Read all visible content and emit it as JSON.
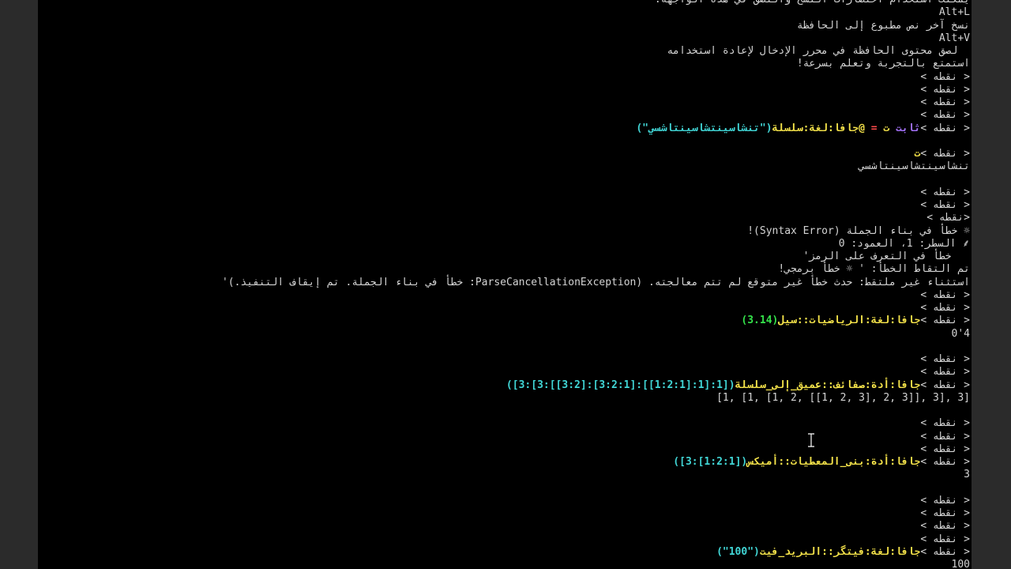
{
  "colors": {
    "background": "#000000",
    "frame": "#2b2b2b",
    "text": "#d4d4d4",
    "keyword_yellow": "#f5e34a",
    "string_cyan": "#41d6d6",
    "number_green": "#34e24a",
    "keyword_purple": "#a774ff",
    "operator_red": "#ff4d4d"
  },
  "terminal": {
    "lines": [
      {
        "segments": [
          {
            "text": "يمكنك استخدام اختصارات النسخ واللصق في هذه الواجهة:",
            "color": "text"
          }
        ]
      },
      {
        "segments": [
          {
            "text": "Alt+L",
            "color": "text"
          }
        ]
      },
      {
        "segments": [
          {
            "text": "نسخ آخر نص مطبوع إلى الحافظة",
            "color": "text"
          }
        ]
      },
      {
        "segments": [
          {
            "text": "Alt+V",
            "color": "text"
          }
        ]
      },
      {
        "segments": [
          {
            "text": "  لصق محتوى الحافظة في محرر الإدخال لإعادة استخدامه",
            "color": "text"
          }
        ]
      },
      {
        "segments": [
          {
            "text": "استمتع بالتجربة وتعلم بسرعة!",
            "color": "text"
          }
        ]
      },
      {
        "segments": [
          {
            "text": "< نقطه >",
            "color": "text"
          }
        ]
      },
      {
        "segments": [
          {
            "text": "< نقطه >",
            "color": "text"
          }
        ]
      },
      {
        "segments": [
          {
            "text": "< نقطه >",
            "color": "text"
          }
        ]
      },
      {
        "segments": [
          {
            "text": "< نقطه >",
            "color": "text"
          }
        ]
      },
      {
        "segments": [
          {
            "text": "< نقطه >",
            "color": "text"
          },
          {
            "text": "ثابت ",
            "color": "purple"
          },
          {
            "text": "ت ",
            "color": "yellow"
          },
          {
            "text": "= ",
            "color": "red"
          },
          {
            "text": "@جافا:لغة:سلسلة",
            "color": "yellow"
          },
          {
            "text": "(\"تنشاسينتشاسينتاشسي\")",
            "color": "cyan"
          }
        ]
      },
      {
        "segments": []
      },
      {
        "segments": [
          {
            "text": "< نقطه >",
            "color": "text"
          },
          {
            "text": "ت",
            "color": "yellow"
          }
        ]
      },
      {
        "segments": [
          {
            "text": "تنشاسينتشاسينتاشسي",
            "color": "text"
          }
        ]
      },
      {
        "segments": []
      },
      {
        "segments": [
          {
            "text": "< نقطه >",
            "color": "text"
          }
        ]
      },
      {
        "segments": [
          {
            "text": "< نقطه >",
            "color": "text"
          }
        ]
      },
      {
        "segments": [
          {
            "text": "<نقطه >",
            "color": "text"
          }
        ]
      },
      {
        "segments": [
          {
            "text": "☼ خطأ في بناء الجملة (Syntax Error)!",
            "color": "text"
          }
        ]
      },
      {
        "segments": [
          {
            "text": "⸙ السطر: 1، العمود: 0",
            "color": "text"
          }
        ]
      },
      {
        "segments": [
          {
            "text": "   خطأ في التعرف على الرمز'",
            "color": "text"
          }
        ]
      },
      {
        "segments": [
          {
            "text": "تم التقاط الخطأ: ' ☼ خطأ برمجي!",
            "color": "text"
          }
        ]
      },
      {
        "segments": [
          {
            "text": "استثناء غير ملتقط: حدث خطأ غير متوقع لم تتم معالجته. (ParseCancellationException: خطأ في بناء الجملة. تم إيقاف التنفيذ.)'",
            "color": "text"
          }
        ]
      },
      {
        "segments": [
          {
            "text": "< نقطه >",
            "color": "text"
          }
        ]
      },
      {
        "segments": [
          {
            "text": "< نقطه >",
            "color": "text"
          }
        ]
      },
      {
        "segments": [
          {
            "text": "< نقطه >",
            "color": "text"
          },
          {
            "text": "جافا:لغة:الرياضيات::سيل",
            "color": "yellow"
          },
          {
            "text": "(3.14)",
            "color": "green"
          }
        ]
      },
      {
        "segments": [
          {
            "text": "4'0",
            "color": "text"
          }
        ]
      },
      {
        "segments": []
      },
      {
        "segments": [
          {
            "text": "< نقطه >",
            "color": "text"
          }
        ]
      },
      {
        "segments": [
          {
            "text": "< نقطه >",
            "color": "text"
          }
        ]
      },
      {
        "segments": [
          {
            "text": "< نقطه >",
            "color": "text"
          },
          {
            "text": "جافا:أدة:صفائف::عميق_إلى_سلسلة",
            "color": "yellow"
          },
          {
            "text": "([1:[1:[1:2:1]]:[3:2:1]:[3:2]]:3]:3])",
            "color": "cyan"
          }
        ]
      },
      {
        "segments": [
          {
            "text": "[1, [1, [1, 2, [[1, 2, 3], 2, 3]], 3], 3]",
            "color": "text"
          }
        ],
        "ltr": true
      },
      {
        "segments": []
      },
      {
        "segments": [
          {
            "text": "< نقطه >",
            "color": "text"
          }
        ]
      },
      {
        "segments": [
          {
            "text": "< نقطه >",
            "color": "text"
          }
        ]
      },
      {
        "segments": [
          {
            "text": "< نقطه >",
            "color": "text"
          }
        ]
      },
      {
        "segments": [
          {
            "text": "< نقطه >",
            "color": "text"
          },
          {
            "text": "جافا:أدة:بنى_المعطيات::أميكس",
            "color": "yellow"
          },
          {
            "text": "([1:2:1]:3])",
            "color": "cyan"
          }
        ]
      },
      {
        "segments": [
          {
            "text": "3",
            "color": "text"
          }
        ]
      },
      {
        "segments": []
      },
      {
        "segments": [
          {
            "text": "< نقطه >",
            "color": "text"
          }
        ]
      },
      {
        "segments": [
          {
            "text": "< نقطه >",
            "color": "text"
          }
        ]
      },
      {
        "segments": [
          {
            "text": "< نقطه >",
            "color": "text"
          }
        ]
      },
      {
        "segments": [
          {
            "text": "< نقطه >",
            "color": "text"
          }
        ]
      },
      {
        "segments": [
          {
            "text": "< نقطه >",
            "color": "text"
          },
          {
            "text": "جافا:لغة:فيتگر::البريد_فيت",
            "color": "yellow"
          },
          {
            "text": "(\"100\")",
            "color": "cyan"
          }
        ]
      },
      {
        "segments": [
          {
            "text": "100",
            "color": "text"
          }
        ]
      }
    ]
  },
  "cursor": {
    "icon": "text-cursor-icon"
  }
}
